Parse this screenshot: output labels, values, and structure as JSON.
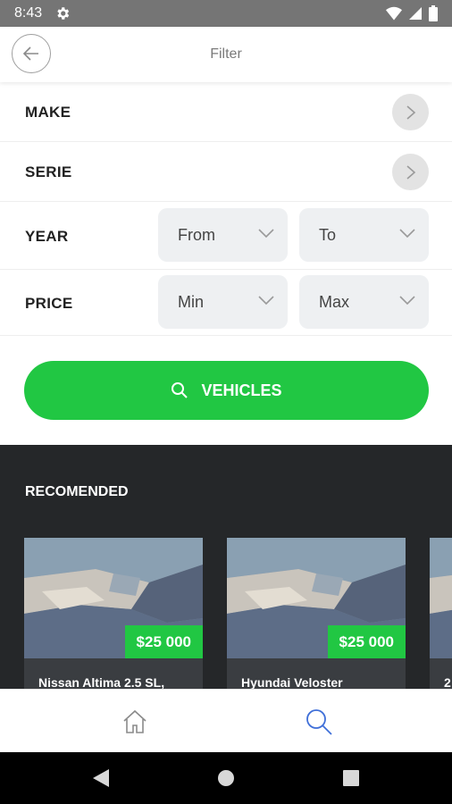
{
  "status_bar": {
    "time": "8:43",
    "icons": [
      "gear-icon",
      "wifi-icon",
      "signal-icon",
      "battery-icon"
    ]
  },
  "header": {
    "title": "Filter",
    "back_icon": "arrow-left-icon"
  },
  "filters": {
    "make": {
      "label": "MAKE"
    },
    "serie": {
      "label": "SERIE"
    },
    "year": {
      "label": "YEAR",
      "from_placeholder": "From",
      "to_placeholder": "To"
    },
    "price": {
      "label": "PRICE",
      "min_placeholder": "Min",
      "max_placeholder": "Max"
    }
  },
  "search_button": {
    "label": "VEHICLES",
    "icon": "search-icon"
  },
  "recommended": {
    "title": "RECOMENDED",
    "cards": [
      {
        "price": "$25 000",
        "name": "Nissan Altima 2.5 SL,"
      },
      {
        "price": "$25 000",
        "name": "Hyundai Veloster"
      },
      {
        "price": "",
        "name": "2"
      }
    ]
  },
  "bottom_nav": {
    "items": [
      "home-icon",
      "search-icon"
    ],
    "active": "search-icon"
  },
  "colors": {
    "accent": "#21c743",
    "dark_bg": "#252729",
    "active_nav": "#3f6fd8"
  }
}
